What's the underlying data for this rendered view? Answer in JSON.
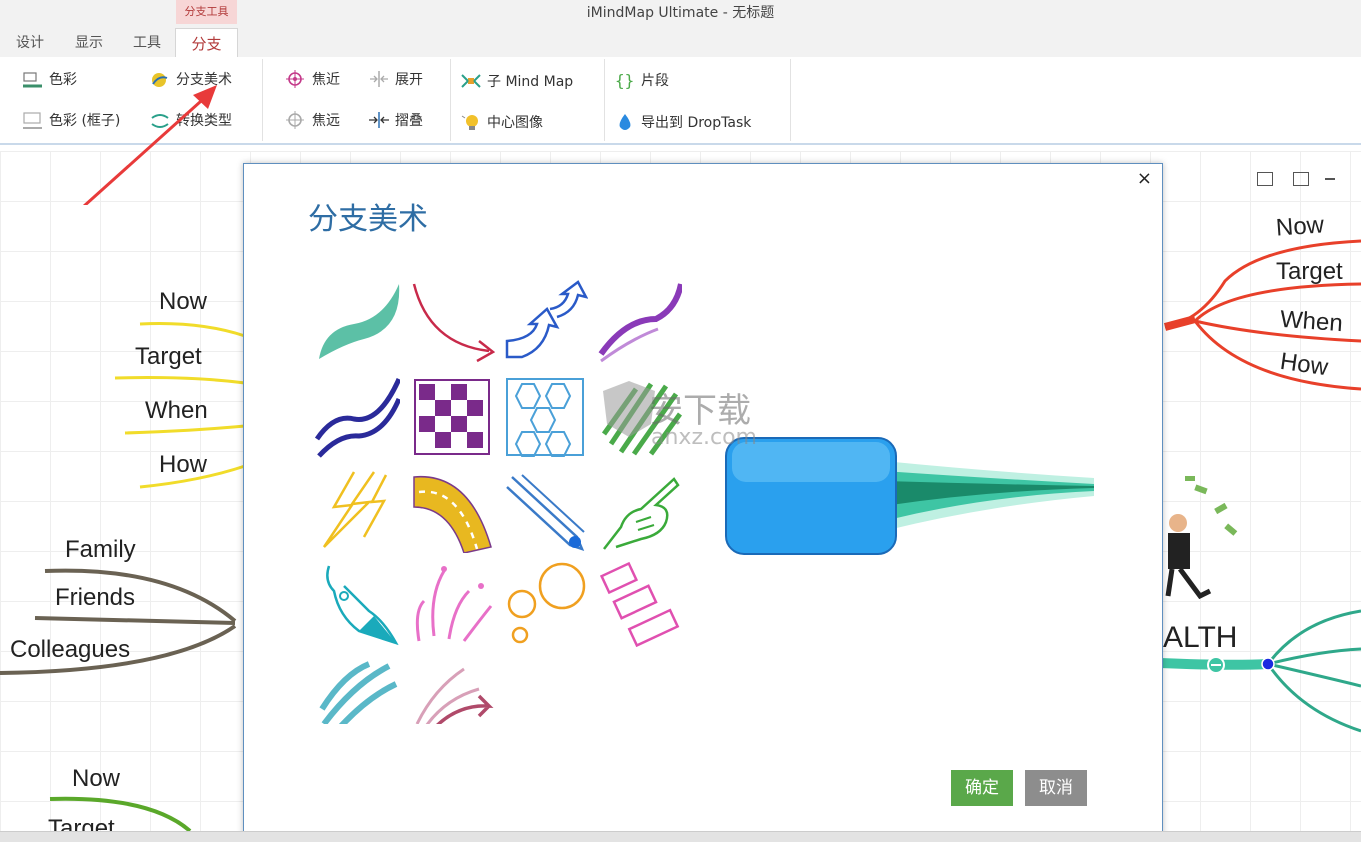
{
  "window": {
    "title": "iMindMap Ultimate - 无标题"
  },
  "context_tab": "分支工具",
  "tabs": [
    {
      "label": "设计",
      "active": false
    },
    {
      "label": "显示",
      "active": false
    },
    {
      "label": "工具",
      "active": false
    },
    {
      "label": "分支",
      "active": true
    }
  ],
  "ribbon": {
    "color": "色彩",
    "color_box": "色彩 (框子)",
    "branch_art": "分支美术",
    "convert_type": "转换类型",
    "focus_in": "焦近",
    "focus_out": "焦远",
    "expand": "展开",
    "collapse": "摺叠",
    "sub_mindmap": "子 Mind Map",
    "central_image": "中心图像",
    "snippet": "片段",
    "export_droptask": "导出到 DropTask"
  },
  "mindmap": {
    "left_top": [
      "Now",
      "Target",
      "When",
      "How"
    ],
    "left_mid": [
      "Family",
      "Friends",
      "Colleagues"
    ],
    "left_bottom": [
      "Now",
      "Target"
    ],
    "right_top": [
      "Now",
      "Target",
      "When",
      "How"
    ],
    "right_node": "ALTH"
  },
  "dialog": {
    "title": "分支美术",
    "close": "×",
    "ok": "确定",
    "cancel": "取消",
    "arts": [
      "teal-swoosh",
      "red-curved-arrow",
      "blue-double-arrow",
      "purple-wave",
      "navy-double-wave",
      "purple-checker",
      "blue-hexagon",
      "green-scribble",
      "yellow-lightning",
      "yellow-road",
      "blue-pencil",
      "green-pointing-hand",
      "teal-fountain-pen",
      "pink-splash",
      "orange-bubbles",
      "pink-rectangles",
      "teal-scribble",
      "maroon-arrow-scribble"
    ]
  },
  "watermark": {
    "text": "安下载",
    "sub": "anxz.com"
  },
  "colors": {
    "accent_red": "#b23a3a",
    "dialog_title": "#2e6da4",
    "ok": "#5aa84a",
    "cancel": "#8d8d8d",
    "preview_blue": "#2aa0ee",
    "preview_teal": "#3ec5a4"
  }
}
